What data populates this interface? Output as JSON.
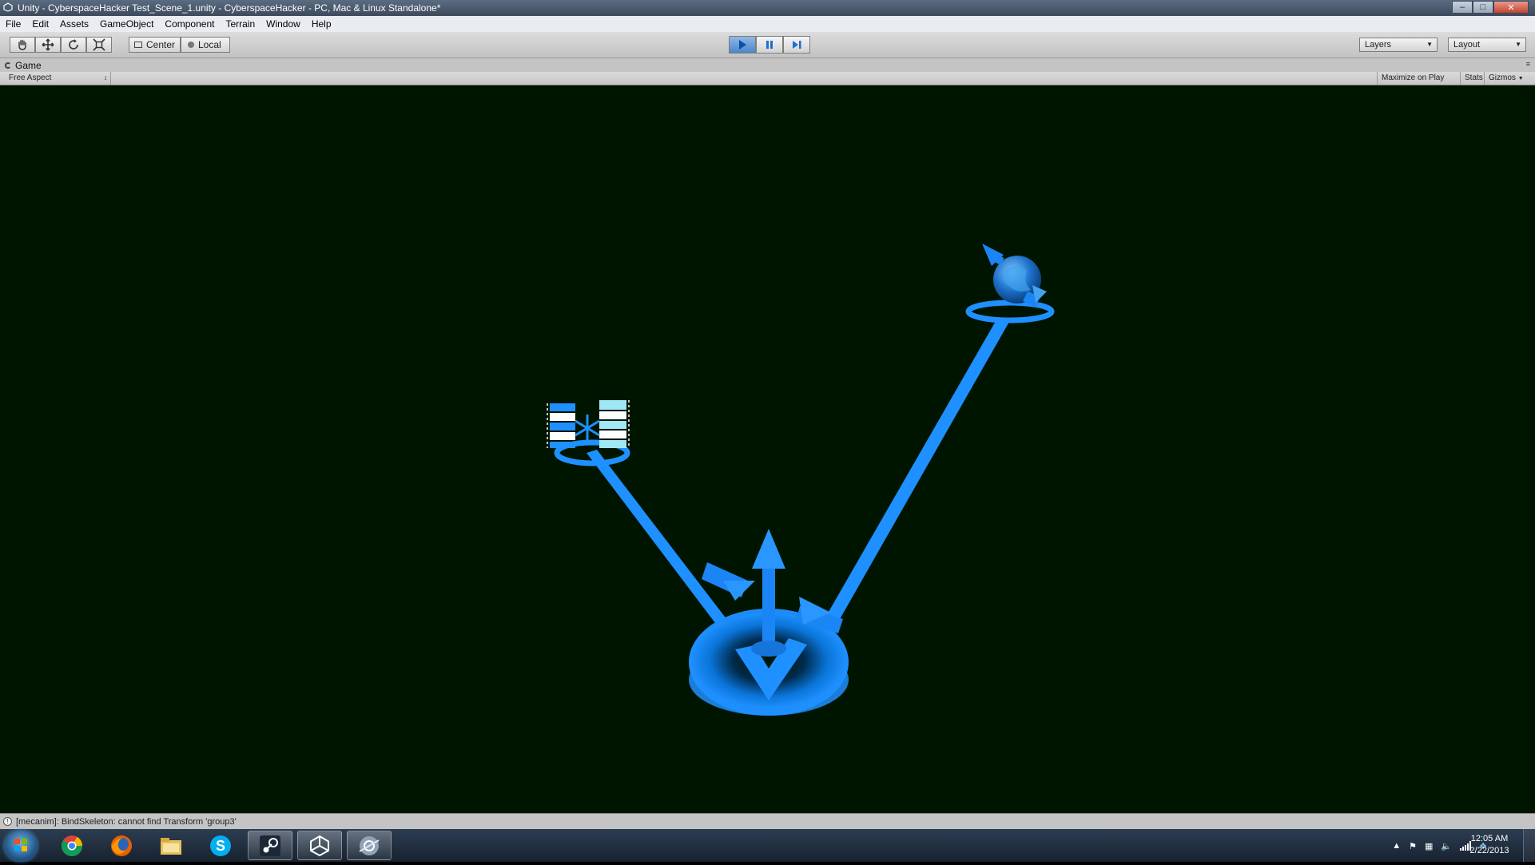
{
  "window": {
    "title": "Unity - CyberspaceHacker Test_Scene_1.unity - CyberspaceHacker - PC, Mac & Linux Standalone*",
    "buttons": [
      "minimize",
      "maximize",
      "close"
    ]
  },
  "menu": {
    "items": [
      "File",
      "Edit",
      "Assets",
      "GameObject",
      "Component",
      "Terrain",
      "Window",
      "Help"
    ]
  },
  "toolbar": {
    "tools": [
      "hand-icon",
      "move-icon",
      "rotate-icon",
      "scale-icon"
    ],
    "pivot_label": "Center",
    "space_label": "Local",
    "play_controls": [
      "play-icon",
      "pause-icon",
      "step-icon"
    ],
    "play_active": true,
    "layers_label": "Layers",
    "layout_label": "Layout"
  },
  "game_panel": {
    "tab_label": "Game",
    "aspect_label": "Free Aspect",
    "maximize_label": "Maximize on Play",
    "stats_label": "Stats",
    "gizmos_label": "Gizmos"
  },
  "scene": {
    "background_color": "#001500",
    "accent_color": "#1e90ff"
  },
  "console": {
    "message": "[mecanim]: BindSkeleton: cannot find Transform 'group3'"
  },
  "taskbar": {
    "apps": [
      "chrome-icon",
      "firefox-icon",
      "explorer-icon",
      "skype-icon",
      "steam-icon",
      "unity-icon",
      "app-icon"
    ],
    "active_apps": [
      "steam-icon",
      "unity-icon",
      "app-icon"
    ],
    "clock_time": "12:05 AM",
    "clock_date": "2/22/2013"
  }
}
